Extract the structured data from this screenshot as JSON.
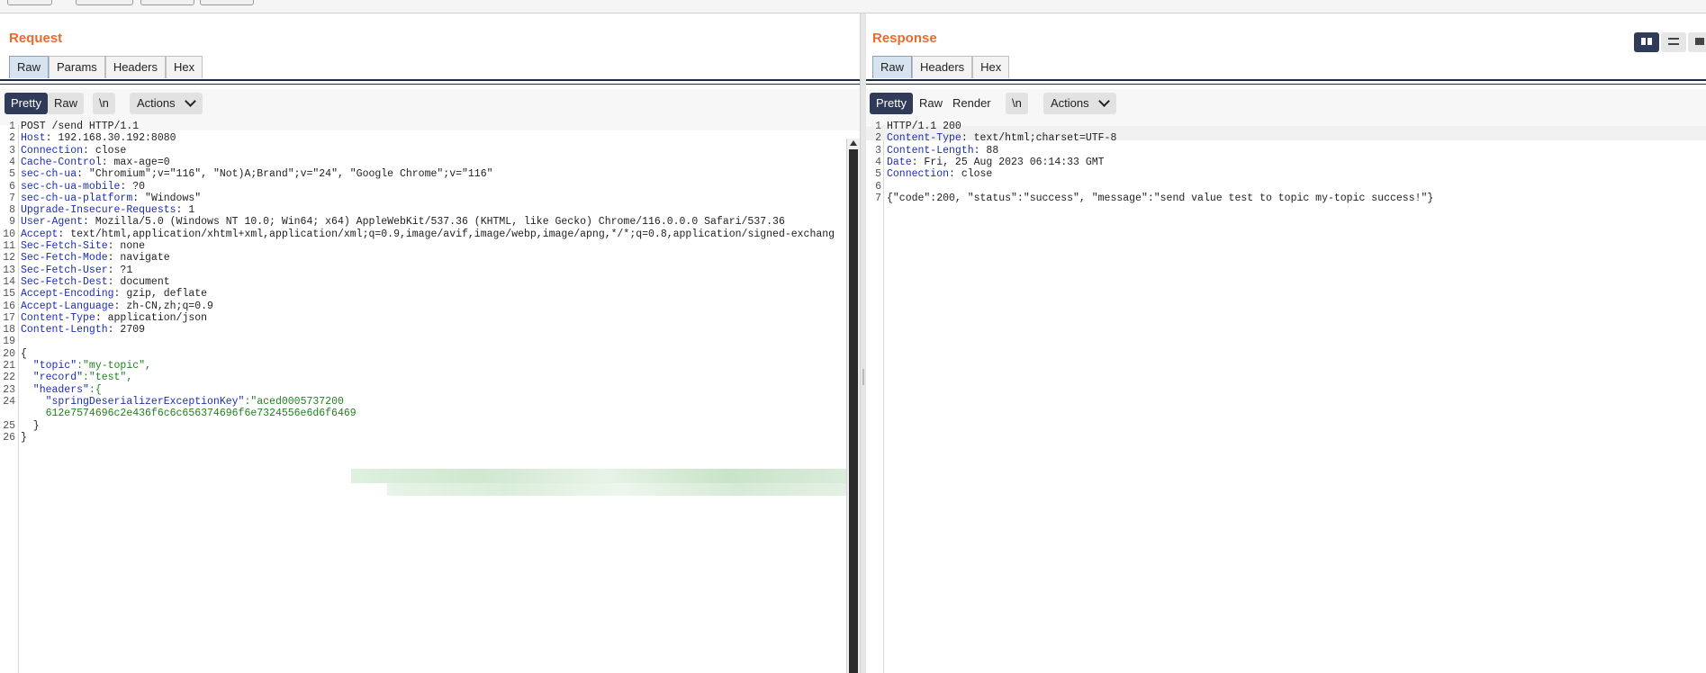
{
  "request": {
    "title": "Request",
    "tabs": [
      "Raw",
      "Params",
      "Headers",
      "Hex"
    ],
    "active_tab": "Raw",
    "toolbar": {
      "pretty": "Pretty",
      "raw": "Raw",
      "newline": "\\n",
      "actions": "Actions"
    },
    "lines": [
      {
        "n": "1",
        "k": "",
        "v": "POST /send HTTP/1.1"
      },
      {
        "n": "2",
        "k": "Host",
        "v": ": 192.168.30.192:8080"
      },
      {
        "n": "3",
        "k": "Connection",
        "v": ": close"
      },
      {
        "n": "4",
        "k": "Cache-Control",
        "v": ": max-age=0"
      },
      {
        "n": "5",
        "k": "sec-ch-ua",
        "v": ": \"Chromium\";v=\"116\", \"Not)A;Brand\";v=\"24\", \"Google Chrome\";v=\"116\""
      },
      {
        "n": "6",
        "k": "sec-ch-ua-mobile",
        "v": ": ?0"
      },
      {
        "n": "7",
        "k": "sec-ch-ua-platform",
        "v": ": \"Windows\""
      },
      {
        "n": "8",
        "k": "Upgrade-Insecure-Requests",
        "v": ": 1"
      },
      {
        "n": "9",
        "k": "User-Agent",
        "v": ": Mozilla/5.0 (Windows NT 10.0; Win64; x64) AppleWebKit/537.36 (KHTML, like Gecko) Chrome/116.0.0.0 Safari/537.36"
      },
      {
        "n": "10",
        "k": "Accept",
        "v": ": text/html,application/xhtml+xml,application/xml;q=0.9,image/avif,image/webp,image/apng,*/*;q=0.8,application/signed-exchang"
      },
      {
        "n": "11",
        "k": "Sec-Fetch-Site",
        "v": ": none"
      },
      {
        "n": "12",
        "k": "Sec-Fetch-Mode",
        "v": ": navigate"
      },
      {
        "n": "13",
        "k": "Sec-Fetch-User",
        "v": ": ?1"
      },
      {
        "n": "14",
        "k": "Sec-Fetch-Dest",
        "v": ": document"
      },
      {
        "n": "15",
        "k": "Accept-Encoding",
        "v": ": gzip, deflate"
      },
      {
        "n": "16",
        "k": "Accept-Language",
        "v": ": zh-CN,zh;q=0.9"
      },
      {
        "n": "17",
        "k": "Content-Type",
        "v": ": application/json"
      },
      {
        "n": "18",
        "k": "Content-Length",
        "v": ": 2709"
      },
      {
        "n": "19",
        "k": "",
        "v": ""
      },
      {
        "n": "20",
        "k": "",
        "v": "{"
      },
      {
        "n": "21",
        "k": "  \"topic\"",
        "v": ":\"my-topic\","
      },
      {
        "n": "22",
        "k": "  \"record\"",
        "v": ":\"test\","
      },
      {
        "n": "23",
        "k": "  \"headers\"",
        "v": ":{"
      },
      {
        "n": "24",
        "k": "    \"springDeserializerExceptionKey\"",
        "v": ":\"aced0005737200"
      },
      {
        "n": "",
        "k": "",
        "v": "    612e7574696c2e436f6c6c656374696f6e7324556e6d6f6469"
      },
      {
        "n": "25",
        "k": "",
        "v": "  }"
      },
      {
        "n": "26",
        "k": "",
        "v": "}"
      }
    ]
  },
  "response": {
    "title": "Response",
    "tabs": [
      "Raw",
      "Headers",
      "Hex"
    ],
    "active_tab": "Raw",
    "toolbar": {
      "pretty": "Pretty",
      "raw": "Raw",
      "render": "Render",
      "newline": "\\n",
      "actions": "Actions"
    },
    "lines": [
      {
        "n": "1",
        "k": "",
        "v": "HTTP/1.1 200"
      },
      {
        "n": "2",
        "k": "Content-Type",
        "v": ": text/html;charset=UTF-8"
      },
      {
        "n": "3",
        "k": "Content-Length",
        "v": ": 88"
      },
      {
        "n": "4",
        "k": "Date",
        "v": ": Fri, 25 Aug 2023 06:14:33 GMT"
      },
      {
        "n": "5",
        "k": "Connection",
        "v": ": close"
      },
      {
        "n": "6",
        "k": "",
        "v": ""
      },
      {
        "n": "7",
        "k": "",
        "v": "{\"code\":200, \"status\":\"success\", \"message\":\"send value test to topic my-topic success!\"}"
      }
    ]
  },
  "colors": {
    "accent": "#e96a2f",
    "active": "#2f3b58",
    "header_key": "#1c2eb0",
    "json_value": "#208020"
  }
}
